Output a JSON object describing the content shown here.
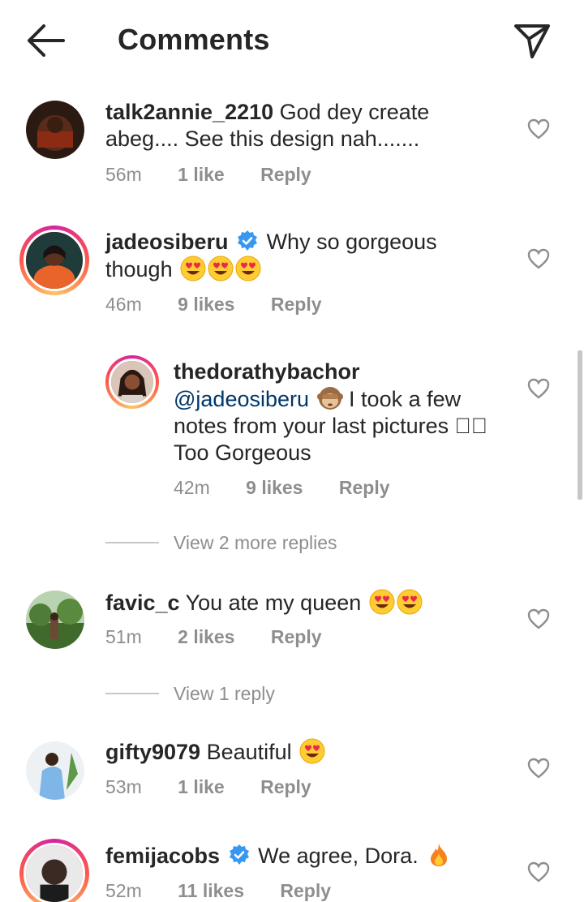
{
  "header": {
    "title": "Comments",
    "back_icon": "arrow-left-icon",
    "send_icon": "paper-plane-icon"
  },
  "colors": {
    "meta_gray": "#8e8e8e",
    "mention_blue": "#00376b",
    "verified_blue": "#3897f0"
  },
  "comments": [
    {
      "username": "talk2annie_2210",
      "verified": false,
      "text": "God dey create abeg.... See this design nah.......",
      "time": "56m",
      "likes": "1 like",
      "reply": "Reply"
    },
    {
      "username": "jadeosiberu",
      "verified": true,
      "text": "Why so gorgeous though",
      "emojis": "heart-eyes x3",
      "time": "46m",
      "likes": "9 likes",
      "reply": "Reply"
    },
    {
      "username": "thedorathybachor",
      "verified": false,
      "mention": "@jadeosiberu",
      "text": "I took a few notes from your last pictures",
      "text_glyph": "\u0000\u0000",
      "text2": "Too Gorgeous",
      "time": "42m",
      "likes": "9 likes",
      "reply": "Reply"
    },
    {
      "username": "favic_c",
      "verified": false,
      "text": "You ate my queen",
      "time": "51m",
      "likes": "2 likes",
      "reply": "Reply"
    },
    {
      "username": "gifty9079",
      "verified": false,
      "text": "Beautiful",
      "time": "53m",
      "likes": "1 like",
      "reply": "Reply"
    },
    {
      "username": "femijacobs",
      "verified": true,
      "text": "We agree, Dora.",
      "time": "52m",
      "likes": "11 likes",
      "reply": "Reply"
    }
  ],
  "view_more": [
    "View 2 more replies",
    "View 1 reply"
  ]
}
